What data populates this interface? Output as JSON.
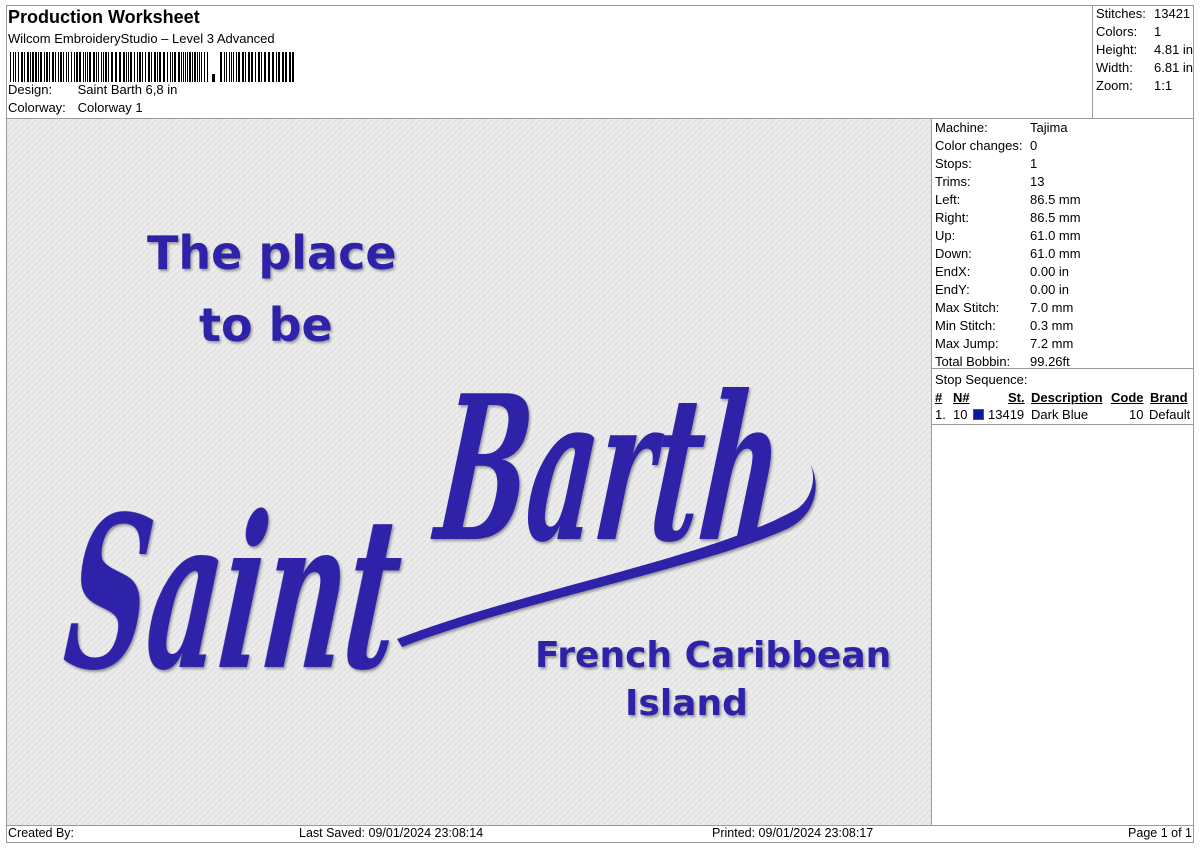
{
  "header": {
    "title": "Production Worksheet",
    "subtitle": "Wilcom EmbroideryStudio – Level 3 Advanced",
    "design_label": "Design:",
    "design_value": "Saint Barth 6,8 in",
    "colorway_label": "Colorway:",
    "colorway_value": "Colorway 1"
  },
  "stats": [
    {
      "label": "Stitches:",
      "value": "13421"
    },
    {
      "label": "Colors:",
      "value": "1"
    },
    {
      "label": "Height:",
      "value": "4.81 in"
    },
    {
      "label": "Width:",
      "value": "6.81 in"
    },
    {
      "label": "Zoom:",
      "value": "1:1"
    }
  ],
  "machine_info": [
    {
      "label": "Machine:",
      "value": "Tajima"
    },
    {
      "label": "Color changes:",
      "value": "0"
    },
    {
      "label": "Stops:",
      "value": "1"
    },
    {
      "label": "Trims:",
      "value": "13"
    },
    {
      "label": "Left:",
      "value": "86.5 mm"
    },
    {
      "label": "Right:",
      "value": "86.5 mm"
    },
    {
      "label": "Up:",
      "value": "61.0 mm"
    },
    {
      "label": "Down:",
      "value": "61.0 mm"
    },
    {
      "label": "EndX:",
      "value": "0.00 in"
    },
    {
      "label": "EndY:",
      "value": "0.00 in"
    },
    {
      "label": "Max Stitch:",
      "value": "7.0 mm"
    },
    {
      "label": "Min Stitch:",
      "value": "0.3 mm"
    },
    {
      "label": "Max Jump:",
      "value": "7.2 mm"
    },
    {
      "label": "Total Bobbin:",
      "value": "99.26ft"
    }
  ],
  "stop_sequence": {
    "label": "Stop Sequence:",
    "headers": {
      "num": "#",
      "n": "N#",
      "st": "St.",
      "description": "Description",
      "code": "Code",
      "brand": "Brand"
    },
    "rows": [
      {
        "num": "1.",
        "n": "10",
        "color": "#0a1a9c",
        "st": "13419",
        "description": "Dark Blue",
        "code": "10",
        "brand": "Default"
      }
    ]
  },
  "design": {
    "line1": "The place",
    "line2": "to be",
    "script1": "Saint",
    "script2": "Barth",
    "line3": "French Caribbean",
    "line4": "Island",
    "thread_color": "#2f23a8"
  },
  "footer": {
    "created_by": "Created By:",
    "last_saved": "Last Saved: 09/01/2024 23:08:14",
    "printed": "Printed: 09/01/2024 23:08:17",
    "page": "Page 1 of 1"
  }
}
